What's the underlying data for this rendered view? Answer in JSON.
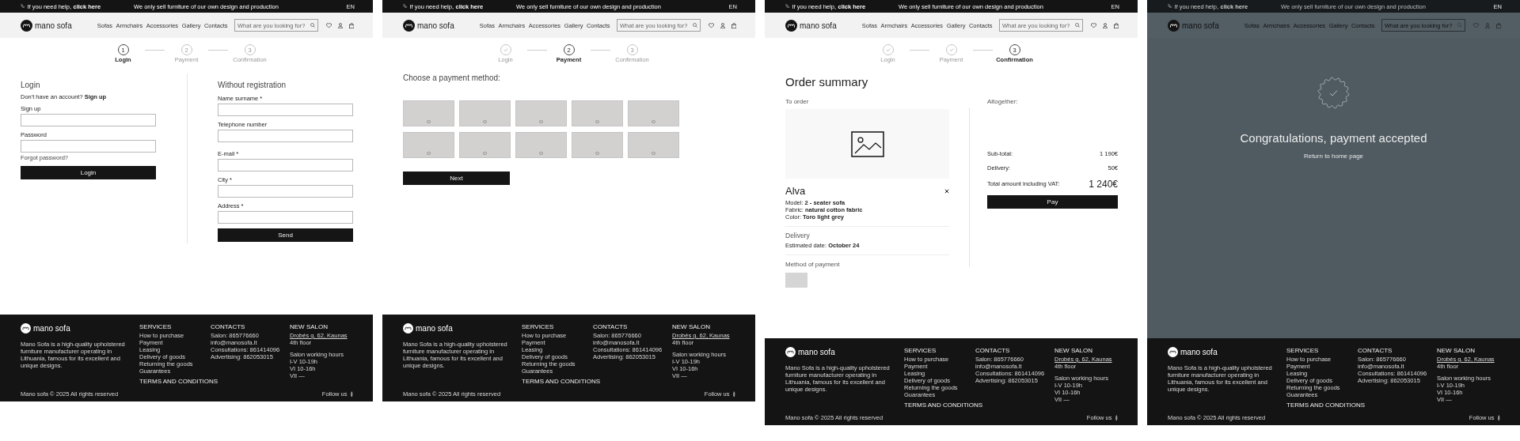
{
  "frames": [
    {
      "header": {
        "help": "If you need help,",
        "help_link": "click here",
        "tagline": "We only sell furniture of our own design and production",
        "language": "EN",
        "logo": "mano sofa",
        "nav": [
          "Sofas",
          "Armchairs",
          "Accessories",
          "Gallery",
          "Contacts"
        ],
        "search_placeholder": "What are you looking for?"
      },
      "steps": [
        {
          "label": "Login",
          "number": "1",
          "completed": false,
          "selected": true
        },
        {
          "label": "Payment",
          "number": "2",
          "completed": false,
          "selected": false
        },
        {
          "label": "Confirmation",
          "number": "3",
          "completed": false,
          "selected": false
        }
      ],
      "content": {
        "kind": "login",
        "login": {
          "title": "Login",
          "prompt": "Don't have an account?",
          "prompt_link": "Sign up",
          "fields": [
            {
              "label": "Sign up"
            },
            {
              "label": "Password"
            }
          ],
          "forgot": "Forgot password?",
          "button": "Login"
        },
        "guest": {
          "title": "Without registration",
          "fields": [
            {
              "label": "Name surname *"
            },
            {
              "label": "Telephone number"
            },
            {
              "label": "E-mail *"
            },
            {
              "label": "City *"
            },
            {
              "label": "Address *"
            }
          ],
          "button": "Send"
        }
      },
      "footer": {
        "logo": "mano sofa",
        "description": "Mano Sofa is a high-quality upholstered furniture manufacturer operating in Lithuania, famous for its excellent and unique designs.",
        "services": {
          "title": "SERVICES",
          "items": [
            "How to purchase",
            "Payment",
            "Leasing",
            "Delivery of goods",
            "Returning the goods",
            "Guarantees"
          ]
        },
        "terms": "TERMS AND CONDITIONS",
        "contacts": {
          "title": "CONTACTS",
          "items": [
            "Salon: 865776660",
            "info@manosofa.lt",
            "Consultations: 861414096",
            "Advertising: 862053015"
          ]
        },
        "salon": {
          "title": "NEW SALON",
          "address": "Drobės g. 62, Kaunas",
          "floor": "4th floor",
          "hours_title": "Salon working hours",
          "hours": [
            "I-V 10-19h",
            "VI 10-16h",
            "VII —"
          ]
        },
        "copyright": "Mano sofa © 2025 All rights reserved",
        "follow": "Follow us"
      }
    },
    {
      "header": {
        "help": "If you need help,",
        "help_link": "click here",
        "tagline": "We only sell furniture of our own design and production",
        "language": "EN",
        "logo": "mano sofa",
        "nav": [
          "Sofas",
          "Armchairs",
          "Accessories",
          "Gallery",
          "Contacts"
        ],
        "search_placeholder": "What are you looking for?"
      },
      "steps": [
        {
          "label": "Login",
          "completed": true,
          "selected": false
        },
        {
          "label": "Payment",
          "number": "2",
          "completed": false,
          "selected": true
        },
        {
          "label": "Confirmation",
          "number": "3",
          "completed": false,
          "selected": false
        }
      ],
      "content": {
        "kind": "payment",
        "title": "Choose a payment method:",
        "methods": [
          {
            "selected": false
          },
          {
            "selected": false
          },
          {
            "selected": false
          },
          {
            "selected": false
          },
          {
            "selected": false
          },
          {
            "selected": false
          },
          {
            "selected": false
          },
          {
            "selected": false
          },
          {
            "selected": false
          },
          {
            "selected": false
          }
        ],
        "button": "Next"
      },
      "footer": {
        "logo": "mano sofa",
        "description": "Mano Sofa is a high-quality upholstered furniture manufacturer operating in Lithuania, famous for its excellent and unique designs.",
        "services": {
          "title": "SERVICES",
          "items": [
            "How to purchase",
            "Payment",
            "Leasing",
            "Delivery of goods",
            "Returning the goods",
            "Guarantees"
          ]
        },
        "terms": "TERMS AND CONDITIONS",
        "contacts": {
          "title": "CONTACTS",
          "items": [
            "Salon: 865776660",
            "info@manosofa.lt",
            "Consultations: 861414096",
            "Advertising: 862053015"
          ]
        },
        "salon": {
          "title": "NEW SALON",
          "address": "Drobės g. 62, Kaunas",
          "floor": "4th floor",
          "hours_title": "Salon working hours",
          "hours": [
            "I-V 10-19h",
            "VI 10-16h",
            "VII —"
          ]
        },
        "copyright": "Mano sofa © 2025 All rights reserved",
        "follow": "Follow us"
      }
    },
    {
      "header": {
        "help": "If you need help,",
        "help_link": "click here",
        "tagline": "We only sell furniture of our own design and production",
        "language": "EN",
        "logo": "mano sofa",
        "nav": [
          "Sofas",
          "Armchairs",
          "Accessories",
          "Gallery",
          "Contacts"
        ],
        "search_placeholder": "What are you looking for?"
      },
      "steps": [
        {
          "label": "Login",
          "completed": true,
          "selected": false
        },
        {
          "label": "Payment",
          "completed": true,
          "selected": false
        },
        {
          "label": "Confirmation",
          "number": "3",
          "completed": false,
          "selected": true
        }
      ],
      "content": {
        "kind": "summary",
        "title": "Order summary",
        "to_order": "To order",
        "product": {
          "name": "Alva",
          "details": [
            "Model: **2 - seater sofa**",
            "Fabric: **natural cotton fabric**",
            "Color: **Toro light grey**"
          ]
        },
        "delivery": {
          "title": "Delivery",
          "text": "Estimated date: **October 24**"
        },
        "payment_title": "Method of payment",
        "totals": {
          "title": "Altogether:",
          "rows": [
            {
              "kind": "line",
              "label": "Sub-total:",
              "value": "1 190€"
            },
            {
              "kind": "line",
              "label": "Delivery:",
              "value": "50€"
            },
            {
              "kind": "total",
              "label": "Total amount including VAT:",
              "value": "1 240€"
            }
          ]
        },
        "button": "Pay"
      },
      "footer": {
        "logo": "mano sofa",
        "description": "Mano Sofa is a high-quality upholstered furniture manufacturer operating in Lithuania, famous for its excellent and unique designs.",
        "services": {
          "title": "SERVICES",
          "items": [
            "How to purchase",
            "Payment",
            "Leasing",
            "Delivery of goods",
            "Returning the goods",
            "Guarantees"
          ]
        },
        "terms": "TERMS AND CONDITIONS",
        "contacts": {
          "title": "CONTACTS",
          "items": [
            "Salon: 865776660",
            "info@manosofa.lt",
            "Consultations: 861414096",
            "Advertising: 862053015"
          ]
        },
        "salon": {
          "title": "NEW SALON",
          "address": "Drobės g. 62, Kaunas",
          "floor": "4th floor",
          "hours_title": "Salon working hours",
          "hours": [
            "I-V 10-19h",
            "VI 10-16h",
            "VII —"
          ]
        },
        "copyright": "Mano sofa © 2025 All rights reserved",
        "follow": "Follow us"
      }
    },
    {
      "header": {
        "help": "If you need help,",
        "help_link": "click here",
        "tagline": "We only sell furniture of our own design and production",
        "language": "EN",
        "logo": "mano sofa",
        "nav": [
          "Sofas",
          "Armchairs",
          "Accessories",
          "Gallery",
          "Contacts"
        ],
        "search_placeholder": "What are you looking for?"
      },
      "content": {
        "kind": "success",
        "title": "Congratulations, payment accepted",
        "link": "Return to home page"
      },
      "footer": {
        "logo": "mano sofa",
        "description": "Mano Sofa is a high-quality upholstered furniture manufacturer operating in Lithuania, famous for its excellent and unique designs.",
        "services": {
          "title": "SERVICES",
          "items": [
            "How to purchase",
            "Payment",
            "Leasing",
            "Delivery of goods",
            "Returning the goods",
            "Guarantees"
          ]
        },
        "terms": "TERMS AND CONDITIONS",
        "contacts": {
          "title": "CONTACTS",
          "items": [
            "Salon: 865776660",
            "info@manosofa.lt",
            "Consultations: 861414096",
            "Advertising: 862053015"
          ]
        },
        "salon": {
          "title": "NEW SALON",
          "address": "Drobės g. 62, Kaunas",
          "floor": "4th floor",
          "hours_title": "Salon working hours",
          "hours": [
            "I-V 10-19h",
            "VI 10-16h",
            "VII —"
          ]
        },
        "copyright": "Mano sofa © 2025 All rights reserved",
        "follow": "Follow us"
      }
    }
  ]
}
